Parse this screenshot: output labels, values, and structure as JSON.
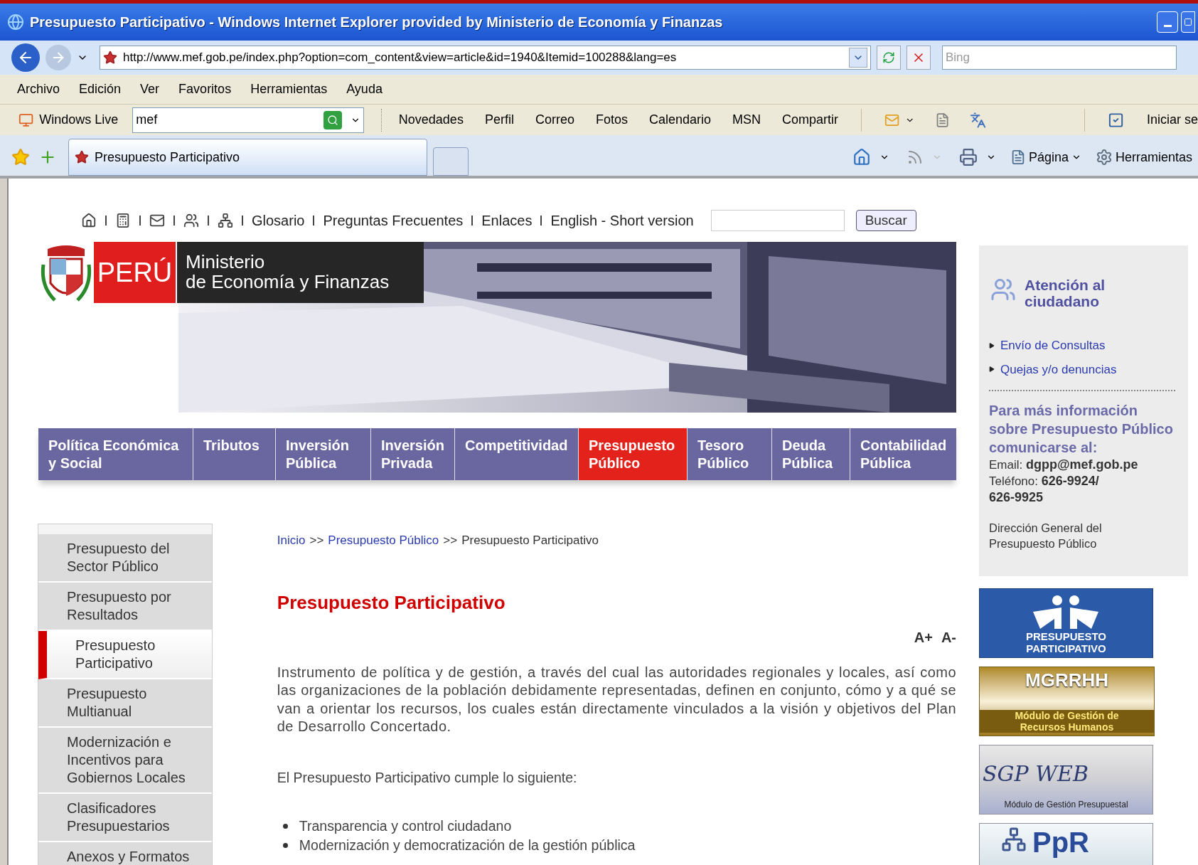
{
  "window": {
    "title": "Presupuesto Participativo - Windows Internet Explorer provided by Ministerio de Economía y Finanzas"
  },
  "address_bar": {
    "url": "http://www.mef.gob.pe/index.php?option=com_content&view=article&id=1940&Itemid=100288&lang=es",
    "search_placeholder": "Bing"
  },
  "menu": [
    "Archivo",
    "Edición",
    "Ver",
    "Favoritos",
    "Herramientas",
    "Ayuda"
  ],
  "live_toolbar": {
    "brand": "Windows Live",
    "search_value": "mef",
    "links": [
      "Novedades",
      "Perfil",
      "Correo",
      "Fotos",
      "Calendario",
      "MSN",
      "Compartir"
    ],
    "sign_in": "Iniciar se"
  },
  "tabs": [
    {
      "label": "Presupuesto Participativo",
      "selected": true
    }
  ],
  "command_bar": {
    "page": "Página",
    "tools": "Herramientas"
  },
  "page": {
    "top_links": [
      "Glosario",
      "Preguntas Frecuentes",
      "Enlaces",
      "English - Short version"
    ],
    "search_button": "Buscar",
    "logo": {
      "country": "PERÚ",
      "ministry_line_1": "Ministerio",
      "ministry_line_2": "de Economía y Finanzas"
    },
    "nav": [
      {
        "label": "Política Económica\ny Social",
        "selected": false
      },
      {
        "label": "Tributos",
        "selected": false
      },
      {
        "label": "Inversión\nPública",
        "selected": false
      },
      {
        "label": "Inversión\nPrivada",
        "selected": false
      },
      {
        "label": "Competitividad",
        "selected": false
      },
      {
        "label": "Presupuesto\nPúblico",
        "selected": true
      },
      {
        "label": "Tesoro\nPúblico",
        "selected": false
      },
      {
        "label": "Deuda\nPública",
        "selected": false
      },
      {
        "label": "Contabilidad\nPública",
        "selected": false
      }
    ],
    "sidebar": [
      {
        "label": "Presupuesto del\nSector Público",
        "selected": false
      },
      {
        "label": "Presupuesto por\nResultados",
        "selected": false
      },
      {
        "label": "Presupuesto\nParticipativo",
        "selected": true
      },
      {
        "label": "Presupuesto\nMultianual",
        "selected": false
      },
      {
        "label": "Modernización e\nIncentivos para\nGobiernos Locales",
        "selected": false
      },
      {
        "label": "Clasificadores\nPresupuestarios",
        "selected": false
      },
      {
        "label": "Anexos y Formatos",
        "selected": false
      }
    ],
    "breadcrumb": [
      {
        "label": "Inicio",
        "kind": "link"
      },
      {
        "label": ">>",
        "kind": "separator"
      },
      {
        "label": "Presupuesto Público",
        "kind": "link"
      },
      {
        "label": ">>",
        "kind": "separator"
      },
      {
        "label": "Presupuesto Participativo",
        "kind": "current"
      }
    ],
    "title": "Presupuesto Participativo",
    "font_controls": [
      "A+",
      "A-"
    ],
    "paragraphs": [
      "Instrumento de política y de gestión, a través del cual las autoridades regionales y locales, así como las organizaciones de la población debidamente representadas, definen en conjunto, cómo y a qué se van a orientar los recursos, los cuales están directamente vinculados a la visión y objetivos del Plan de Desarrollo Concertado.",
      "El Presupuesto Participativo cumple lo siguiente:"
    ],
    "bullets": [
      "Transparencia y control ciudadano",
      "Modernización y democratización de la gestión pública"
    ],
    "contact": {
      "title": "Atención al\nciudadano",
      "links": [
        "Envío de Consultas",
        "Quejas y/o denuncias"
      ],
      "info": "Para más información sobre Presupuesto Público comunicarse al:",
      "email": "Email: **dgpp@mef.gob.pe**",
      "phone": "Teléfono: **626-9924/** **626-9925**",
      "footer": "Dirección General del\nPresupuesto Público"
    },
    "banners": [
      {
        "kind": "participativo",
        "text": "PRESUPUESTO\nPARTICIPATIVO"
      },
      {
        "kind": "mgrrhh",
        "title": "MGRRHH",
        "text": "Módulo de Gestión de\nRecursos Humanos"
      },
      {
        "kind": "sgp",
        "title": "SGP WEB",
        "text": "Módulo de Gestión Presupuestal"
      },
      {
        "kind": "ppr",
        "title": "PpR"
      }
    ]
  }
}
